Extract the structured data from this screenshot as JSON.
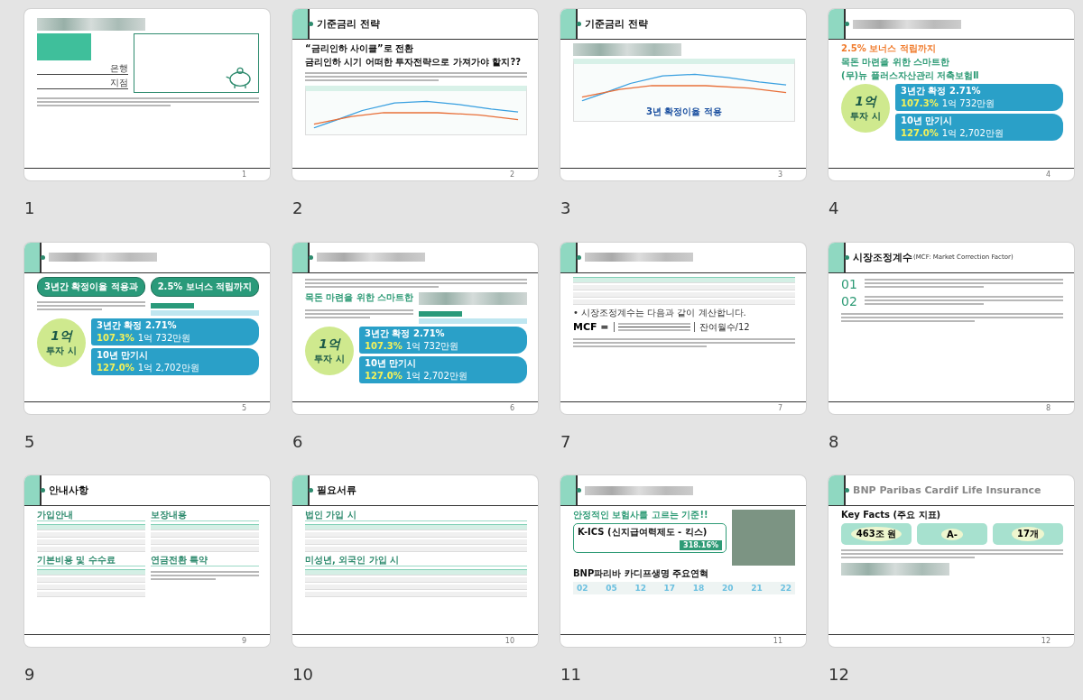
{
  "slides": [
    {
      "label": "1",
      "page_number": "1",
      "blocks": [
        {
          "kind": "redacted"
        },
        {
          "kind": "row",
          "children": [
            {
              "kind": "col",
              "children": [
                {
                  "kind": "square"
                },
                {
                  "kind": "field",
                  "text": "은행"
                },
                {
                  "kind": "field",
                  "text": "지점"
                }
              ]
            },
            {
              "kind": "piggy"
            }
          ]
        },
        {
          "kind": "lines"
        }
      ]
    },
    {
      "label": "2",
      "page_number": "2",
      "header": {
        "kind": "title",
        "text": "기준금리 전략"
      },
      "blocks": [
        {
          "kind": "heading",
          "text": "“금리인하 사이클”로 전환"
        },
        {
          "kind": "heading",
          "text": "금리인하 시기 어떠한 투자전략으로 가져가야 할지??"
        },
        {
          "kind": "lines"
        },
        {
          "kind": "chart"
        }
      ]
    },
    {
      "label": "3",
      "page_number": "3",
      "header": {
        "kind": "title",
        "text": "기준금리 전략"
      },
      "blocks": [
        {
          "kind": "redacted"
        },
        {
          "kind": "chart",
          "text": "3년 확정이율 적용"
        }
      ]
    },
    {
      "label": "4",
      "page_number": "4",
      "header": {
        "kind": "redacted"
      },
      "blocks": [
        {
          "kind": "orange",
          "text": "2.5% 보너스 적립까지"
        },
        {
          "kind": "accent",
          "text": "목돈 마련을 위한 스마트한"
        },
        {
          "kind": "accent",
          "text": "(무)뉴 플러스자산관리 저축보험Ⅱ"
        },
        {
          "kind": "row",
          "children": [
            {
              "kind": "circle",
              "value": "1억",
              "caption": "투자 시"
            },
            {
              "kind": "col",
              "children": [
                {
                  "kind": "result",
                  "title": "3년간 확정 2.71%",
                  "percent": "107.3%",
                  "amount": "1억 732만원"
                },
                {
                  "kind": "result",
                  "title": "10년 만기시",
                  "percent": "127.0%",
                  "amount": "1억 2,702만원"
                }
              ]
            }
          ]
        }
      ]
    },
    {
      "label": "5",
      "page_number": "5",
      "header": {
        "kind": "redacted"
      },
      "blocks": [
        {
          "kind": "row",
          "children": [
            {
              "kind": "pill",
              "text": "3년간 확정이율 적용과"
            },
            {
              "kind": "pill",
              "text": "2.5% 보너스 적립까지"
            }
          ]
        },
        {
          "kind": "row",
          "children": [
            {
              "kind": "lines"
            },
            {
              "kind": "timeline"
            }
          ]
        },
        {
          "kind": "row",
          "children": [
            {
              "kind": "circle",
              "value": "1억",
              "caption": "투자 시"
            },
            {
              "kind": "col",
              "children": [
                {
                  "kind": "result",
                  "title": "3년간 확정 2.71%",
                  "percent": "107.3%",
                  "amount": "1억 732만원"
                },
                {
                  "kind": "result",
                  "title": "10년 만기시",
                  "percent": "127.0%",
                  "amount": "1억 2,702만원"
                }
              ]
            }
          ]
        }
      ]
    },
    {
      "label": "6",
      "page_number": "6",
      "header": {
        "kind": "redacted"
      },
      "blocks": [
        {
          "kind": "lines"
        },
        {
          "kind": "row",
          "children": [
            {
              "kind": "accent",
              "text": "목돈 마련을 위한 스마트한"
            },
            {
              "kind": "redacted"
            }
          ]
        },
        {
          "kind": "row",
          "children": [
            {
              "kind": "lines"
            },
            {
              "kind": "timeline"
            }
          ]
        },
        {
          "kind": "row",
          "children": [
            {
              "kind": "circle",
              "value": "1억",
              "caption": "투자 시"
            },
            {
              "kind": "col",
              "children": [
                {
                  "kind": "result",
                  "title": "3년간 확정 2.71%",
                  "percent": "107.3%",
                  "amount": "1억 732만원"
                },
                {
                  "kind": "result",
                  "title": "10년 만기시",
                  "percent": "127.0%",
                  "amount": "1억 2,702만원"
                }
              ]
            }
          ]
        }
      ]
    },
    {
      "label": "7",
      "page_number": "7",
      "header": {
        "kind": "redacted"
      },
      "blocks": [
        {
          "kind": "table"
        },
        {
          "kind": "text",
          "text": "• 시장조정계수는 다음과 같이 계산합니다."
        },
        {
          "kind": "formula",
          "text": "MCF =",
          "suffix": "잔여월수/12"
        },
        {
          "kind": "lines"
        }
      ]
    },
    {
      "label": "8",
      "page_number": "8",
      "header": {
        "kind": "title",
        "text": "시장조정계수",
        "subtitle": "(MCF: Market Correction Factor)"
      },
      "blocks": [
        {
          "kind": "numbered",
          "number": "01"
        },
        {
          "kind": "numbered",
          "number": "02"
        },
        {
          "kind": "lines"
        }
      ]
    },
    {
      "label": "9",
      "page_number": "9",
      "header": {
        "kind": "title",
        "text": "안내사항"
      },
      "blocks": [
        {
          "kind": "row",
          "children": [
            {
              "kind": "col",
              "children": [
                {
                  "kind": "section",
                  "text": "가입안내"
                },
                {
                  "kind": "table"
                }
              ]
            },
            {
              "kind": "col",
              "children": [
                {
                  "kind": "section",
                  "text": "보장내용"
                },
                {
                  "kind": "table"
                }
              ]
            }
          ]
        },
        {
          "kind": "row",
          "children": [
            {
              "kind": "col",
              "children": [
                {
                  "kind": "section",
                  "text": "기본비용 및 수수료"
                },
                {
                  "kind": "table"
                }
              ]
            },
            {
              "kind": "col",
              "children": [
                {
                  "kind": "section",
                  "text": "연금전환 특약"
                },
                {
                  "kind": "lines"
                }
              ]
            }
          ]
        }
      ]
    },
    {
      "label": "10",
      "page_number": "10",
      "header": {
        "kind": "title",
        "text": "필요서류"
      },
      "blocks": [
        {
          "kind": "section",
          "text": "법인 가입 시"
        },
        {
          "kind": "table"
        },
        {
          "kind": "section",
          "text": "미성년, 외국인 가입 시"
        },
        {
          "kind": "table"
        }
      ]
    },
    {
      "label": "11",
      "page_number": "11",
      "header": {
        "kind": "redacted"
      },
      "blocks": [
        {
          "kind": "row",
          "children": [
            {
              "kind": "col",
              "children": [
                {
                  "kind": "accent",
                  "text": "안정적인 보험사를 고르는 기준!!"
                },
                {
                  "kind": "metric",
                  "title": "K-ICS (신지급여력제도 - 킥스)",
                  "value": "318.16%"
                }
              ]
            },
            {
              "kind": "photo"
            }
          ]
        },
        {
          "kind": "heading",
          "text": "BNP파리바 카디프생명 주요연혁"
        },
        {
          "kind": "history",
          "items": [
            "02",
            "05",
            "12",
            "17",
            "18",
            "20",
            "21",
            "22"
          ]
        }
      ]
    },
    {
      "label": "12",
      "page_number": "12",
      "header": {
        "kind": "title",
        "text": "BNP Paribas Cardif Life Insurance",
        "muted": true
      },
      "blocks": [
        {
          "kind": "heading",
          "text": "Key Facts (주요 지표)"
        },
        {
          "kind": "row",
          "children": [
            {
              "kind": "fact",
              "value": "463조 원"
            },
            {
              "kind": "fact",
              "value": "A-"
            },
            {
              "kind": "fact",
              "value": "17개"
            }
          ]
        },
        {
          "kind": "lines"
        },
        {
          "kind": "redacted"
        }
      ]
    }
  ]
}
